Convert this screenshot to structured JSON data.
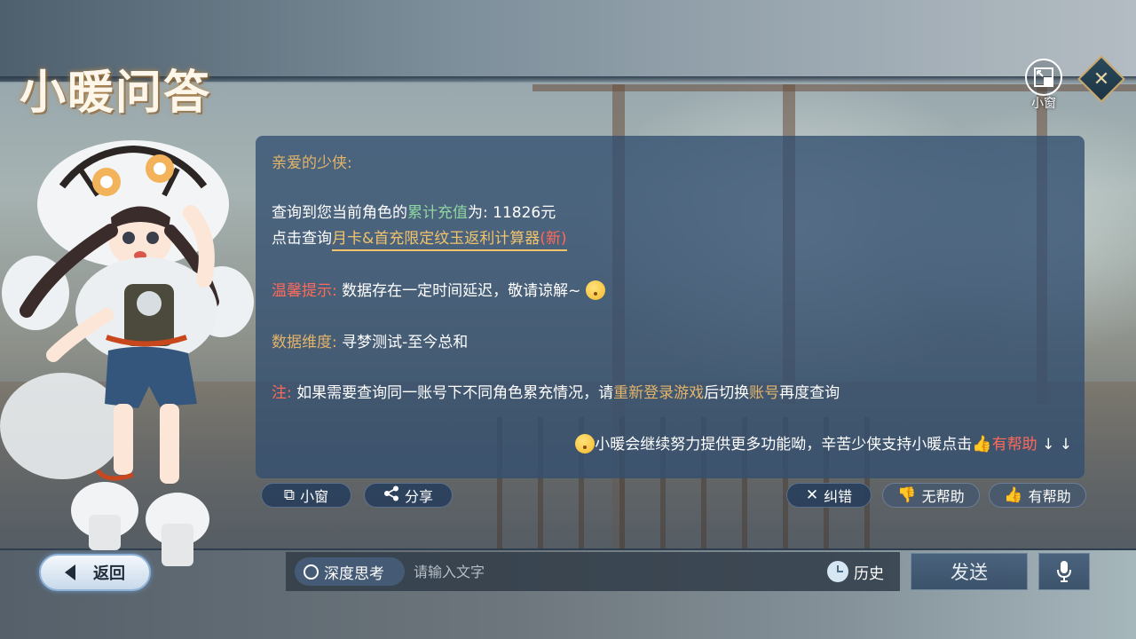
{
  "header": {
    "title": "小暖问答",
    "mini_window_label": "小窗",
    "close_icon": "close-icon"
  },
  "message": {
    "greeting": "亲爱的少侠:",
    "query_prefix": "查询到您当前角色的",
    "query_highlight": "累计充值",
    "query_suffix": "为: 11826元",
    "link_prefix": "点击查询",
    "link_text": "月卡&首充限定纹玉返利计算器",
    "link_new": "(新)",
    "tip_label": "温馨提示:",
    "tip_text": "数据存在一定时间延迟，敬请谅解~",
    "dimension_label": "数据维度:",
    "dimension_text": "寻梦测试-至今总和",
    "note_label": "注:",
    "note_prefix": "如果需要查询同一账号下不同角色累充情况，请",
    "note_relogin": "重新登录游戏",
    "note_middle": "后切换",
    "note_account": "账号",
    "note_suffix": "再度查询",
    "footer_text": "小暖会继续努力提供更多功能呦，辛苦少侠支持小暖点击",
    "footer_helpful": "有帮助",
    "footer_arrows": "↓ ↓"
  },
  "actions": {
    "mini_window": "小窗",
    "share": "分享",
    "correct": "纠错",
    "not_helpful": "无帮助",
    "helpful": "有帮助"
  },
  "bottom": {
    "back": "返回",
    "deep_think": "深度思考",
    "input_placeholder": "请输入文字",
    "history": "历史",
    "send": "发送"
  },
  "colors": {
    "panel_bg": "#324e70",
    "gold": "#e2b46a",
    "red": "#ff6a5a",
    "green": "#8ed6a0"
  }
}
